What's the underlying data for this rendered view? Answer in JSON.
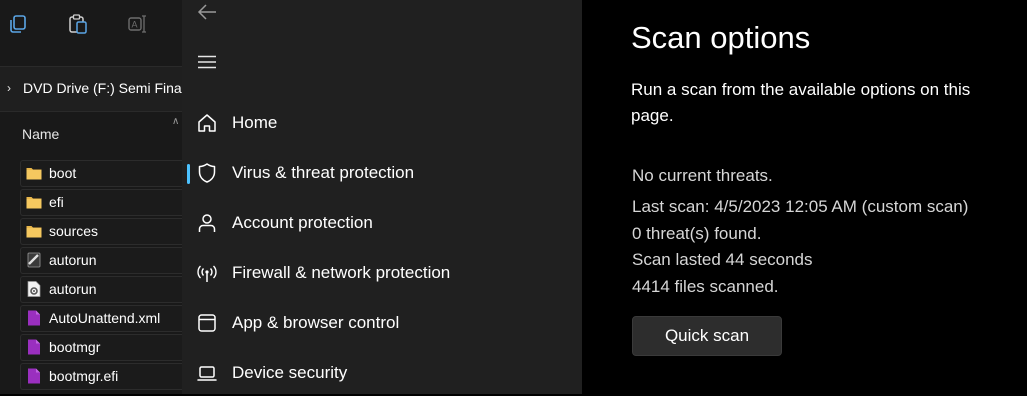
{
  "explorer": {
    "address": "DVD Drive (F:) Semi Fina",
    "column_header": "Name",
    "files": [
      {
        "name": "boot",
        "icon": "folder-icon"
      },
      {
        "name": "efi",
        "icon": "folder-icon"
      },
      {
        "name": "sources",
        "icon": "folder-icon"
      },
      {
        "name": "autorun",
        "icon": "autorun-icon"
      },
      {
        "name": "autorun",
        "icon": "config-file-icon"
      },
      {
        "name": "AutoUnattend.xml",
        "icon": "purple-file-icon"
      },
      {
        "name": "bootmgr",
        "icon": "purple-file-icon"
      },
      {
        "name": "bootmgr.efi",
        "icon": "purple-file-icon"
      }
    ]
  },
  "nav": {
    "items": [
      {
        "label": "Home",
        "icon": "home-icon"
      },
      {
        "label": "Virus & threat protection",
        "icon": "shield-icon",
        "active": true
      },
      {
        "label": "Account protection",
        "icon": "person-icon"
      },
      {
        "label": "Firewall & network protection",
        "icon": "antenna-icon"
      },
      {
        "label": "App & browser control",
        "icon": "window-icon"
      },
      {
        "label": "Device security",
        "icon": "laptop-icon"
      }
    ]
  },
  "content": {
    "title": "Scan options",
    "description": "Run a scan from the available options on this page.",
    "status": "No current threats.",
    "last_scan": "Last scan: 4/5/2023 12:05 AM (custom scan)",
    "threats_found": "0 threat(s) found.",
    "duration": "Scan lasted 44 seconds",
    "files_scanned": "4414 files scanned.",
    "quick_scan_label": "Quick scan"
  },
  "colors": {
    "accent": "#4cc2ff",
    "folder": "#e8b64a",
    "purple_file": "#9a2fbf"
  }
}
